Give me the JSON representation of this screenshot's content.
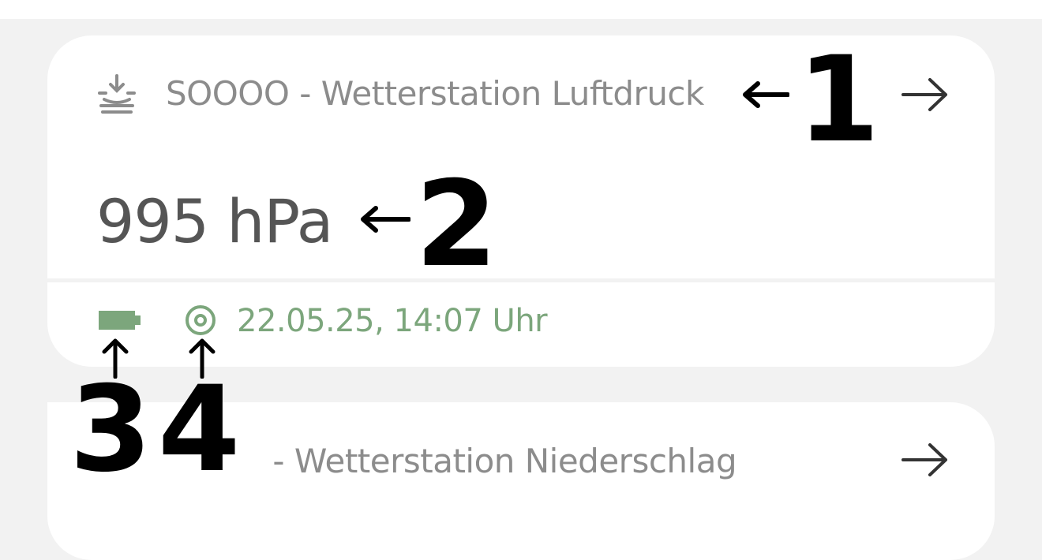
{
  "colors": {
    "background": "#f2f2f2",
    "card": "#ffffff",
    "title_gray": "#8c8c8c",
    "value_gray": "#555555",
    "status_green": "#7ca67c"
  },
  "cards": [
    {
      "icon": "sensor-download-icon",
      "title": "SOOOO - Wetterstation Luftdruck",
      "value": "995 hPa",
      "battery_icon": "battery-icon",
      "visibility_icon": "eye-icon",
      "timestamp": "22.05.25, 14:07 Uhr",
      "arrow_icon": "arrow-right-icon"
    },
    {
      "title": "O - Wetterstation Niederschlag",
      "arrow_icon": "arrow-right-icon"
    }
  ],
  "annotations": [
    "1",
    "2",
    "3",
    "4"
  ]
}
